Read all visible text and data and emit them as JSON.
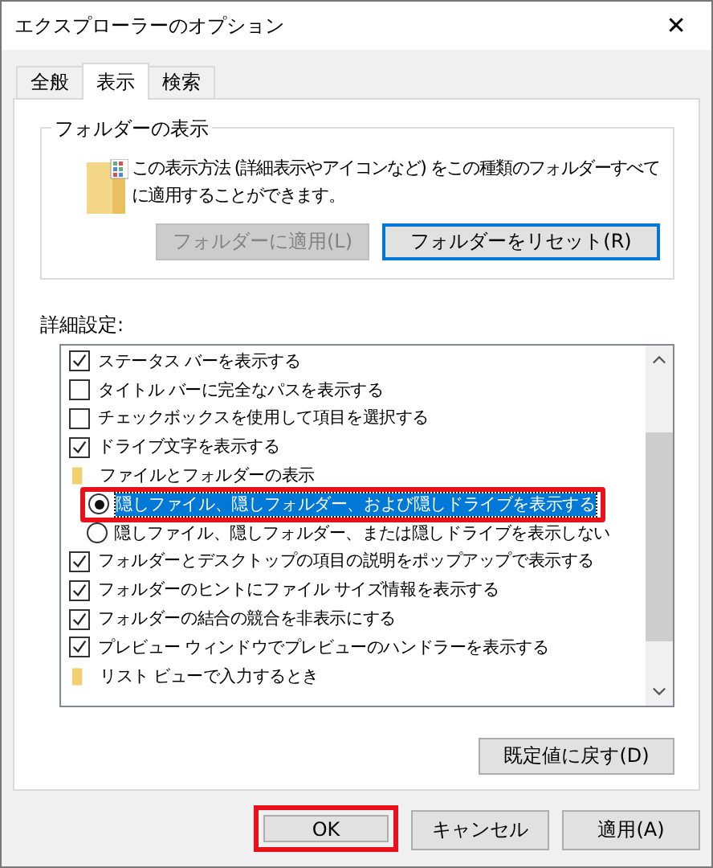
{
  "window": {
    "title": "エクスプローラーのオプション",
    "close": "✕"
  },
  "tabs": [
    {
      "label": "全般",
      "selected": false
    },
    {
      "label": "表示",
      "selected": true
    },
    {
      "label": "検索",
      "selected": false
    }
  ],
  "folder_view": {
    "title": "フォルダーの表示",
    "description": "この表示方法 (詳細表示やアイコンなど) をこの種類のフォルダーすべてに適用することができます。",
    "buttons": [
      {
        "label": "フォルダーに適用(L)",
        "disabled": true,
        "focused": false
      },
      {
        "label": "フォルダーをリセット(R)",
        "disabled": false,
        "focused": true
      }
    ]
  },
  "advanced": {
    "title": "詳細設定:",
    "items": [
      {
        "kind": "checkbox",
        "label": "ステータス バーを表示する",
        "checked": true
      },
      {
        "kind": "checkbox",
        "label": "タイトル バーに完全なパスを表示する",
        "checked": false
      },
      {
        "kind": "checkbox",
        "label": "チェックボックスを使用して項目を選択する",
        "checked": false
      },
      {
        "kind": "checkbox",
        "label": "ドライブ文字を表示する",
        "checked": true
      },
      {
        "kind": "folder",
        "label": "ファイルとフォルダーの表示",
        "children": [
          {
            "kind": "radio",
            "label": "隠しファイル、隠しフォルダー、および隠しドライブを表示する",
            "selected": true,
            "highlighted": true
          },
          {
            "kind": "radio",
            "label": "隠しファイル、隠しフォルダー、または隠しドライブを表示しない",
            "selected": false,
            "highlighted": false
          }
        ]
      },
      {
        "kind": "checkbox",
        "label": "フォルダーとデスクトップの項目の説明をポップアップで表示する",
        "checked": true
      },
      {
        "kind": "checkbox",
        "label": "フォルダーのヒントにファイル サイズ情報を表示する",
        "checked": true
      },
      {
        "kind": "checkbox",
        "label": "フォルダーの結合の競合を非表示にする",
        "checked": true
      },
      {
        "kind": "checkbox",
        "label": "プレビュー ウィンドウでプレビューのハンドラーを表示する",
        "checked": true
      },
      {
        "kind": "folder",
        "label": "リスト ビューで入力するとき"
      }
    ],
    "reset_button": "既定値に戻す(D)"
  },
  "buttons": [
    {
      "label": "OK",
      "highlighted": true
    },
    {
      "label": "キャンセル",
      "highlighted": false
    },
    {
      "label": "適用(A)",
      "highlighted": false
    }
  ]
}
